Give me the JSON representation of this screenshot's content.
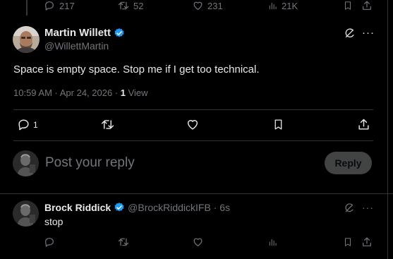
{
  "prev_tweet_actions": {
    "replies": "217",
    "retweets": "52",
    "likes": "231",
    "views": "21K"
  },
  "main_tweet": {
    "display_name": "Martin Willett",
    "handle": "@WillettMartin",
    "text": "Space is empty space. Stop me if I get too technical.",
    "time": "10:59 AM · Apr 24, 2026 · ",
    "views_count": "1",
    "views_label": " View",
    "reply_count": "1",
    "verified_color": "#1d9bf0"
  },
  "composer": {
    "placeholder": "Post your reply",
    "reply_button": "Reply"
  },
  "reply_tweet": {
    "display_name": "Brock Riddick",
    "handle": "@BrockRiddickIFB",
    "time": " · 6s",
    "text": "stop"
  },
  "icons": {
    "grok": "grok-icon",
    "more": "more-icon",
    "reply": "reply-icon",
    "retweet": "retweet-icon",
    "like": "heart-icon",
    "views": "views-icon",
    "bookmark": "bookmark-icon",
    "share": "share-icon"
  }
}
